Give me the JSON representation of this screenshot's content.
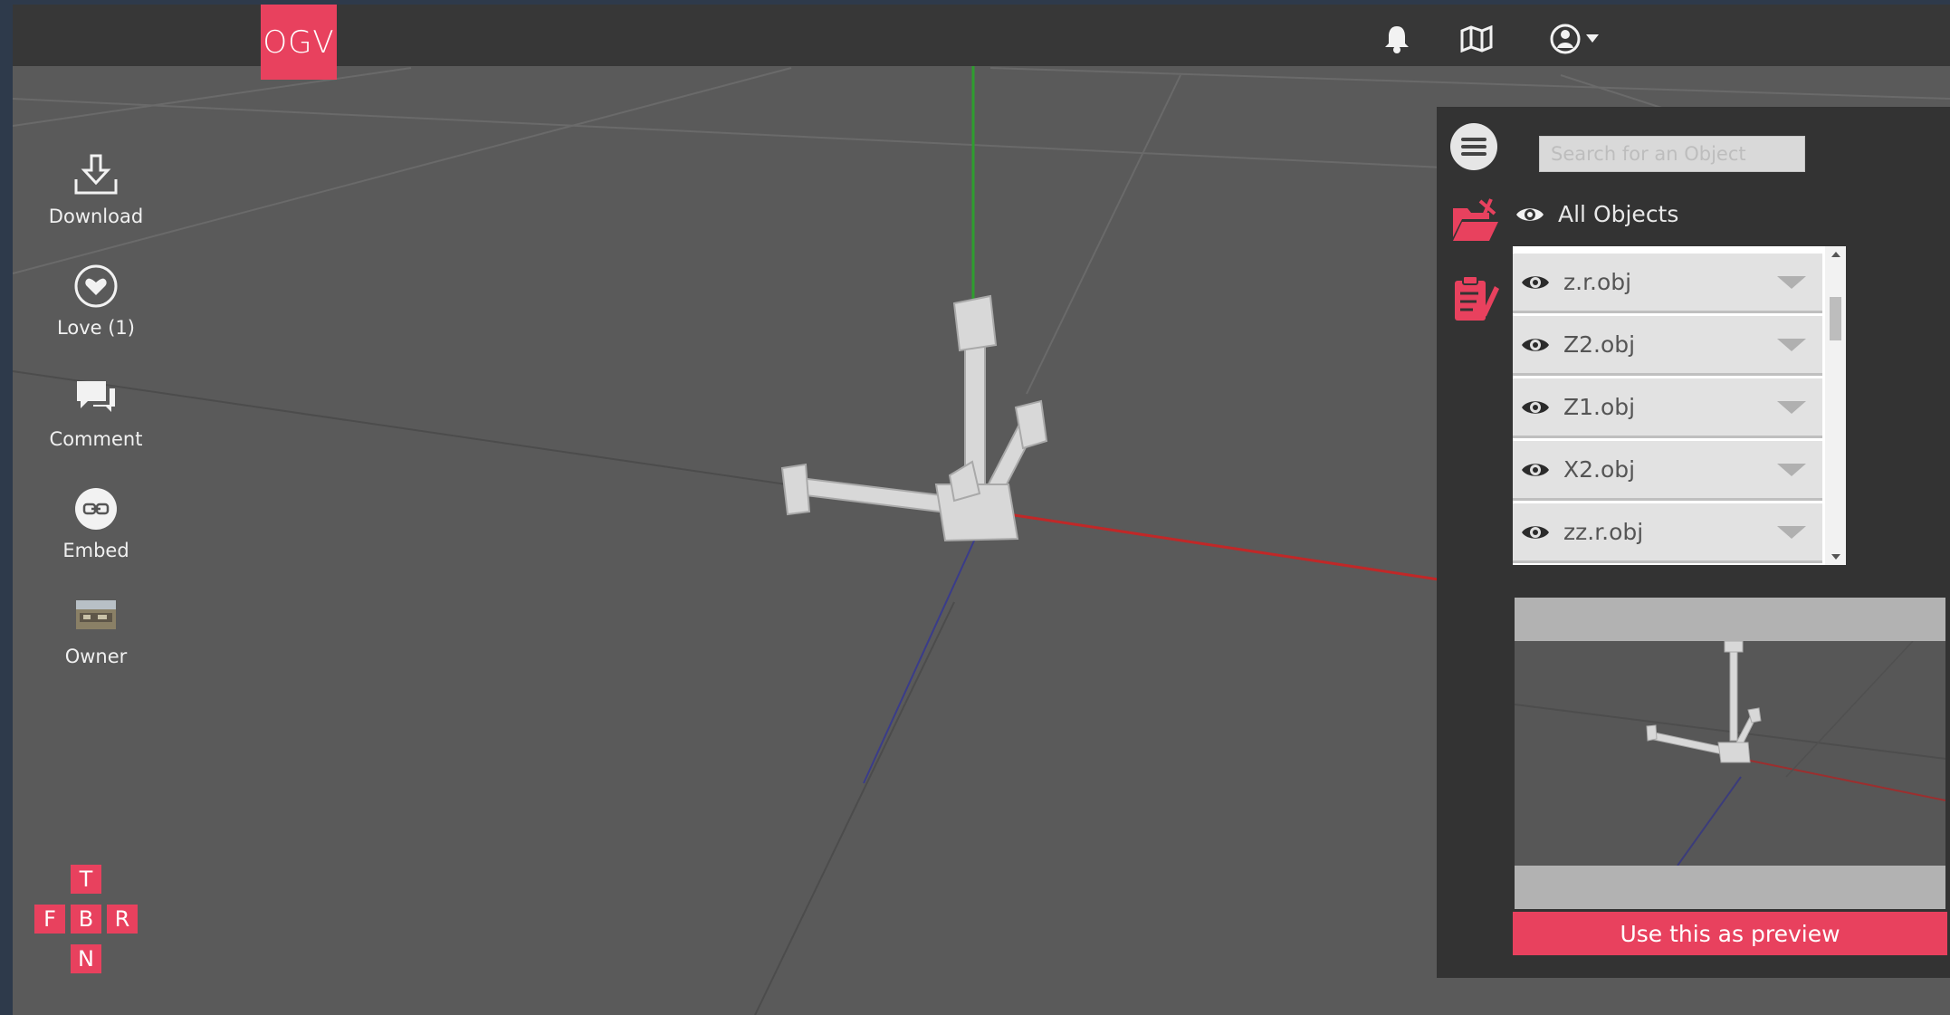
{
  "header": {
    "logo_text": "OGV",
    "icons": [
      "bell-icon",
      "map-icon",
      "user-icon",
      "caret-down-icon"
    ]
  },
  "tools": [
    {
      "label": "Download",
      "icon": "download-icon"
    },
    {
      "label": "Love (1)",
      "icon": "heart-icon"
    },
    {
      "label": "Comment",
      "icon": "comment-icon"
    },
    {
      "label": "Embed",
      "icon": "embed-icon"
    },
    {
      "label": "Owner",
      "icon": "owner-avatar"
    }
  ],
  "view_buttons": {
    "top": "T",
    "front": "F",
    "back": "B",
    "right": "R",
    "bottom": "N"
  },
  "panel": {
    "search_placeholder": "Search for an Object",
    "all_objects_label": "All Objects",
    "objects": [
      "z.r.obj",
      "Z2.obj",
      "Z1.obj",
      "X2.obj",
      "zz.r.obj"
    ],
    "use_preview_label": "Use this as preview"
  },
  "colors": {
    "accent": "#e8415e",
    "viewport": "#5a5a5a",
    "topbar": "#373737",
    "panel": "#333333"
  }
}
